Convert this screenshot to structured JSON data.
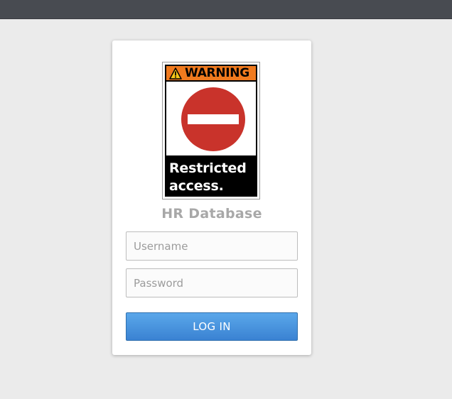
{
  "sign": {
    "header": "WARNING",
    "footer": "Restricted\naccess.",
    "colors": {
      "header": "#f07a1e",
      "no_entry": "#c9332b",
      "background": "#000000"
    },
    "icons": [
      "warning-triangle-icon",
      "no-entry-icon"
    ]
  },
  "app": {
    "title": "HR Database"
  },
  "login_form": {
    "username_placeholder": "Username",
    "password_placeholder": "Password",
    "submit_label": "LOG IN"
  },
  "colors": {
    "topbar": "#484b51",
    "page_background": "#ebebeb",
    "button": "#4a94df"
  }
}
